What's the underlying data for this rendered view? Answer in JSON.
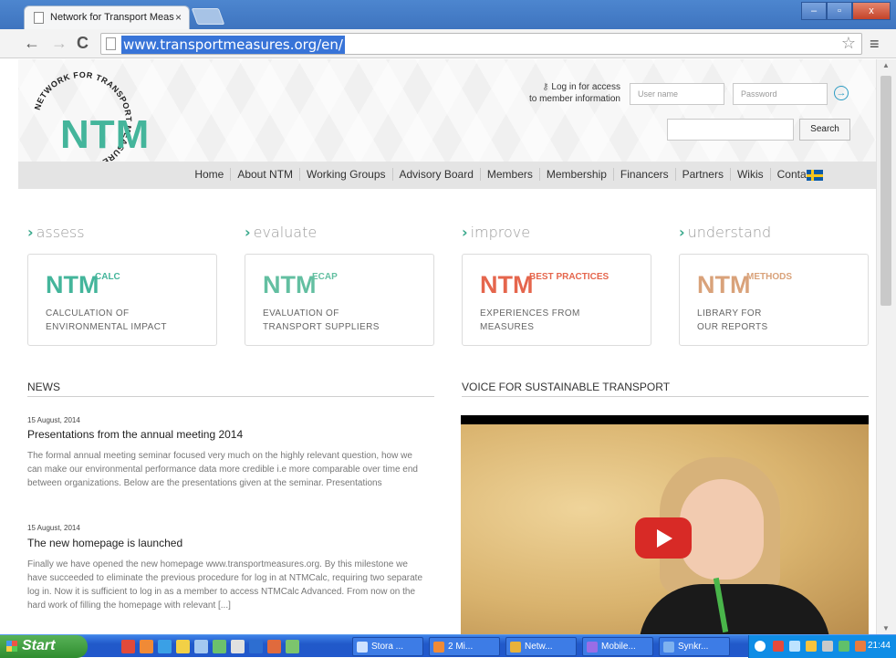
{
  "browser": {
    "tab_title": "Network for Transport Meas",
    "tab_close": "×",
    "url": "www.transportmeasures.org/en/",
    "back": "←",
    "forward": "→",
    "reload": "C",
    "star": "☆",
    "menu": "≡",
    "minimize": "–",
    "maximize": "▫",
    "close": "x"
  },
  "header": {
    "logo_text": "NTM",
    "logo_ring_text": "NETWORK FOR TRANSPORT MEASURES",
    "login_label_line1": "Log in for access",
    "login_label_line2": "to member information",
    "username_placeholder": "User name",
    "password_placeholder": "Password",
    "go_label": "→",
    "search_label": "Search"
  },
  "nav": {
    "items": [
      "Home",
      "About NTM",
      "Working Groups",
      "Advisory Board",
      "Members",
      "Membership",
      "Financers",
      "Partners",
      "Wikis",
      "Contact"
    ]
  },
  "categories": [
    {
      "heading": "assess",
      "brand": "NTM",
      "sub": "CALC",
      "desc1": "CALCULATION OF",
      "desc2": "ENVIRONMENTAL IMPACT",
      "color": "#44b59b"
    },
    {
      "heading": "evaluate",
      "brand": "NTM",
      "sub": "ECAP",
      "desc1": "EVALUATION OF",
      "desc2": "TRANSPORT SUPPLIERS",
      "color": "#63bfa1"
    },
    {
      "heading": "improve",
      "brand": "NTM",
      "sub": "BEST PRACTICES",
      "desc1": "EXPERIENCES FROM",
      "desc2": "MEASURES",
      "color": "#e5664d"
    },
    {
      "heading": "understand",
      "brand": "NTM",
      "sub": "METHODS",
      "desc1": "LIBRARY FOR",
      "desc2": "OUR REPORTS",
      "color": "#d9a27a"
    }
  ],
  "news": {
    "title": "NEWS",
    "items": [
      {
        "date": "15 August, 2014",
        "title": "Presentations from the annual meeting 2014",
        "body": "The formal annual meeting seminar focused very much on the highly relevant question, how we can make our environmental performance data more credible i.e more comparable over time end between organizations. Below are the presentations given at the seminar. Presentations"
      },
      {
        "date": "15 August, 2014",
        "title": "The new homepage is launched",
        "body": "Finally we have opened the new homepage  www.transportmeasures.org. By this milestone we have succeeded to eliminate the previous procedure for log in at NTMCalc, requiring two separate log in. Now it is sufficient to log in as a member to access NTMCalc Advanced. From now on the hard work of filling the homepage with relevant [...]"
      }
    ]
  },
  "voice": {
    "title": "VOICE FOR SUSTAINABLE TRANSPORT"
  },
  "taskbar": {
    "start": "Start",
    "tasks": [
      "Stora ...",
      "2 Mi...",
      "Netw...",
      "Mobile...",
      "Synkr..."
    ],
    "clock": "21:44"
  }
}
